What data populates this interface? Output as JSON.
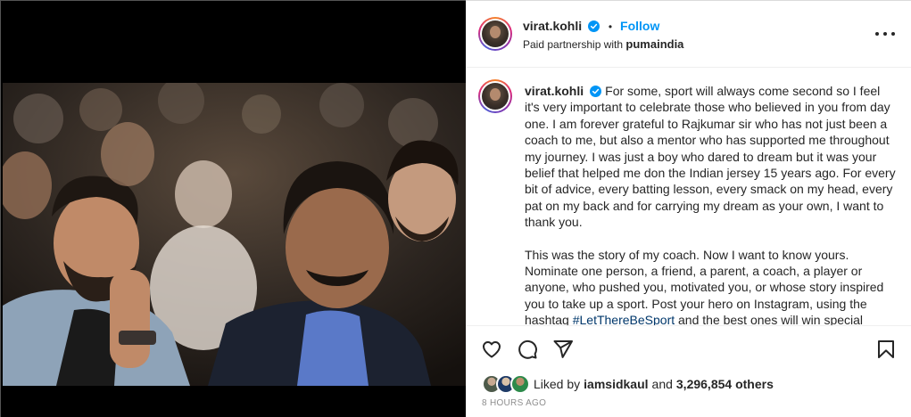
{
  "post": {
    "username": "virat.kohli",
    "verified_icon": "verified-badge-icon",
    "follow_label": "Follow",
    "partnership_prefix": "Paid partnership with",
    "partner": "pumaindia",
    "more_icon": "more-options-icon",
    "photo_alt": "Virat Kohli seated next to his coach in an audience"
  },
  "caption": {
    "username": "virat.kohli",
    "paragraph1": "For some, sport will always come second so I feel it's very important to celebrate those who believed in you from day one. I am forever grateful to Rajkumar sir who has not just been a coach to me, but also a mentor who has supported me throughout my journey. I was just a boy who dared to dream but it was your belief that helped me don the Indian jersey 15 years ago. For every bit of advice, every batting lesson, every smack on my head, every pat on my back and for carrying my dream as your own, I want to thank you.",
    "paragraph2_before": "This was the story of my coach. Now I want to know yours. Nominate one person, a friend, a parent, a coach, a player or anyone, who pushed you, motivated you, or whose story inspired you to take up a sport. Post your hero on Instagram, using the hashtag ",
    "hashtag": "#LetThereBeSport",
    "paragraph2_after": " and the best ones will win special"
  },
  "actions": {
    "like_icon": "heart-icon",
    "comment_icon": "comment-icon",
    "share_icon": "share-icon",
    "save_icon": "bookmark-icon"
  },
  "likes": {
    "prefix": "Liked by",
    "liker": "iamsidkaul",
    "connector": "and",
    "others": "3,296,854 others"
  },
  "timestamp": "8 HOURS AGO",
  "colors": {
    "accent_blue": "#0095f6",
    "hashtag": "#00376b",
    "text": "#262626",
    "muted": "#8e8e8e"
  }
}
